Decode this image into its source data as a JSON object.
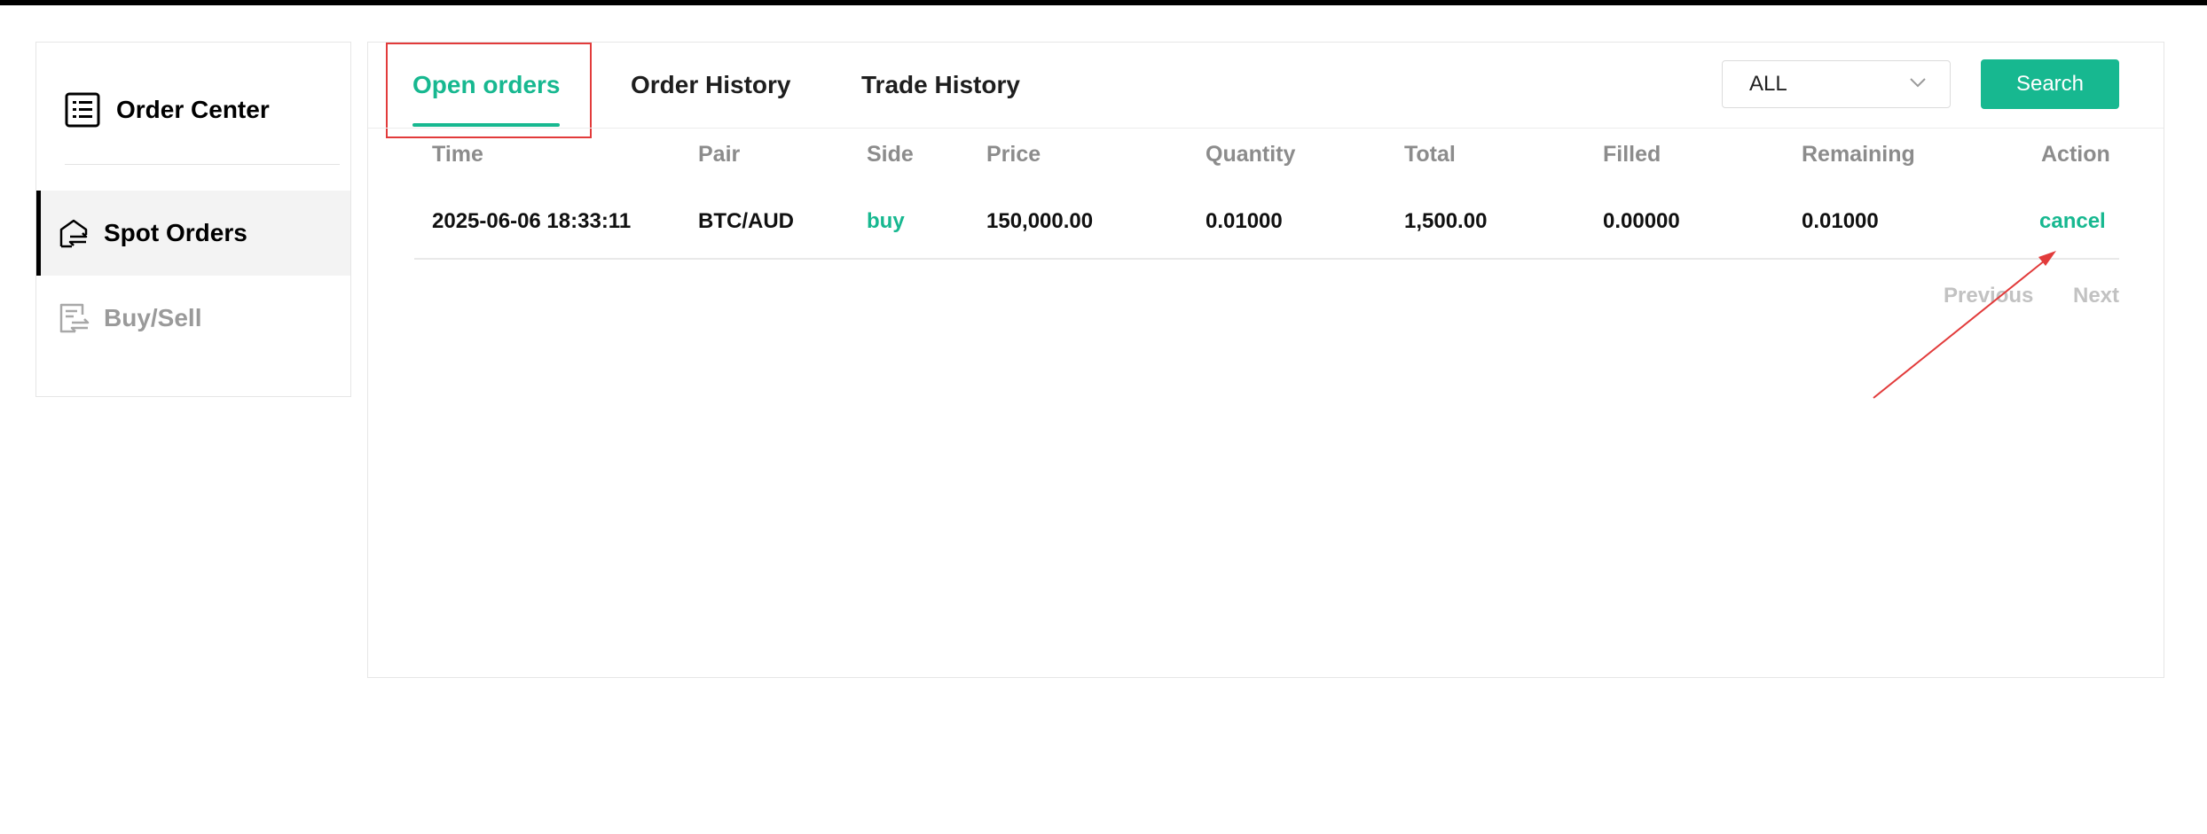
{
  "sidebar": {
    "title": "Order Center",
    "items": [
      {
        "label": "Spot Orders",
        "active": true
      },
      {
        "label": "Buy/Sell",
        "active": false
      }
    ]
  },
  "tabs": [
    {
      "label": "Open orders",
      "active": true
    },
    {
      "label": "Order History",
      "active": false
    },
    {
      "label": "Trade History",
      "active": false
    }
  ],
  "filter": {
    "selected": "ALL"
  },
  "search_label": "Search",
  "table": {
    "columns": [
      "Time",
      "Pair",
      "Side",
      "Price",
      "Quantity",
      "Total",
      "Filled",
      "Remaining",
      "Action"
    ],
    "rows": [
      {
        "time": "2025-06-06 18:33:11",
        "pair": "BTC/AUD",
        "side": "buy",
        "price": "150,000.00",
        "quantity": "0.01000",
        "total": "1,500.00",
        "filled": "0.00000",
        "remaining": "0.01000",
        "action": "cancel"
      }
    ]
  },
  "pagination": {
    "previous": "Previous",
    "next": "Next"
  },
  "colors": {
    "accent": "#17b890",
    "annotation": "#e23b3b"
  }
}
